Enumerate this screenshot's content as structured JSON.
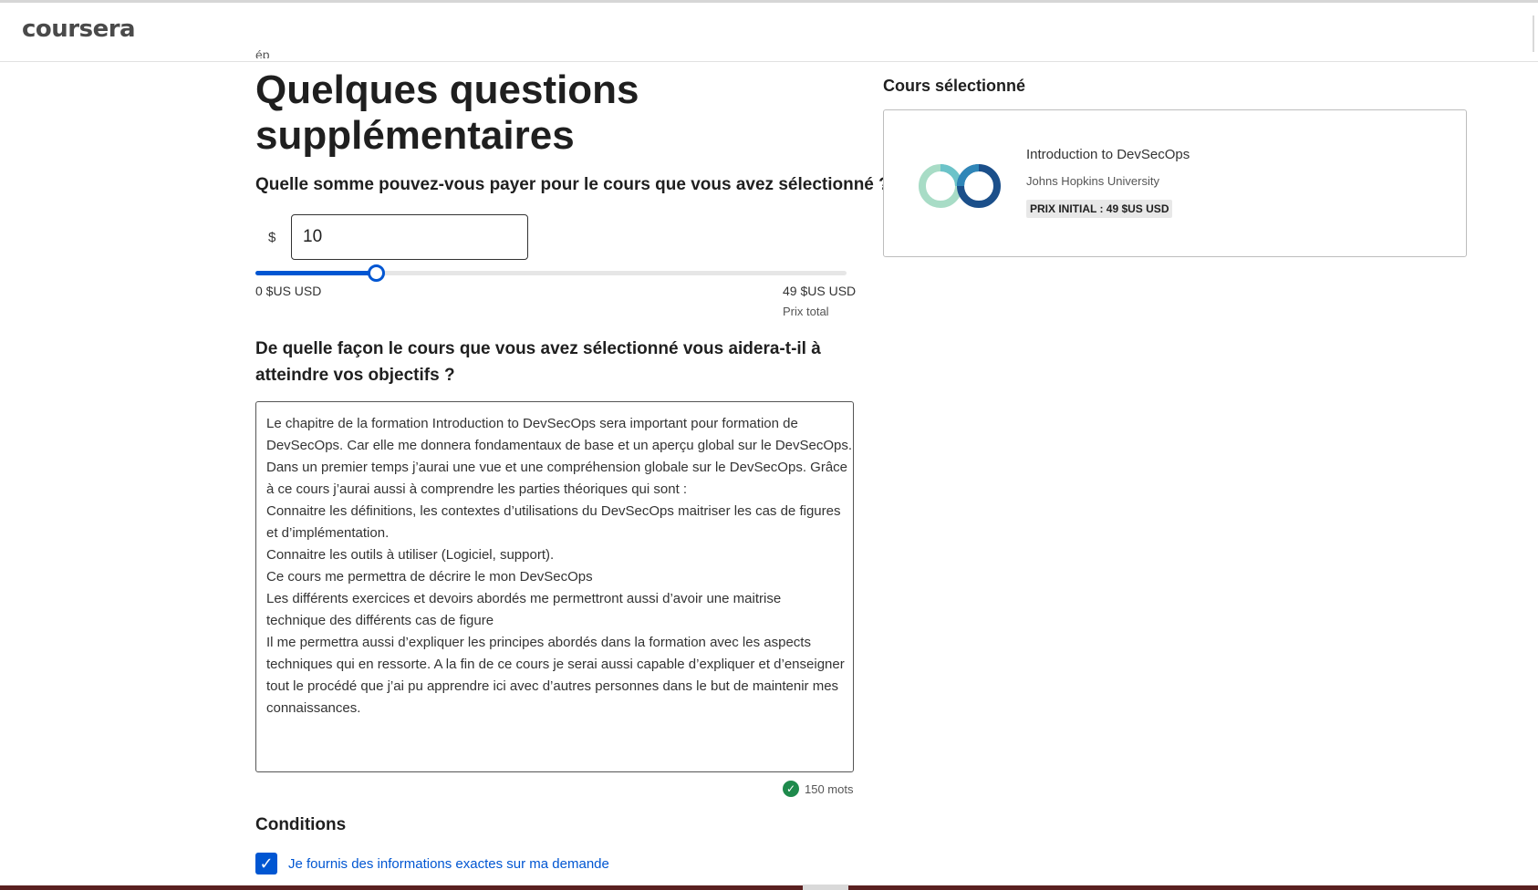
{
  "header": {
    "logo_text": "coursera"
  },
  "form": {
    "title": "Quelques questions supplémentaires",
    "amount_question": "Quelle somme pouvez-vous payer pour le cours que vous avez sélectionné ?",
    "currency_symbol": "$",
    "amount_value": "10",
    "slider": {
      "min_label": "0 $US USD",
      "max_label": "49 $US USD",
      "total_label": "Prix total",
      "value": 10,
      "max": 49
    },
    "goals_question": "De quelle façon le cours que vous avez sélectionné vous aidera-t-il à atteindre vos objectifs ?",
    "goals_lines": [
      "Le chapitre de la formation Introduction to DevSecOps sera important pour formation de",
      "DevSecOps. Car elle me donnera fondamentaux de base et un aperçu global sur le DevSecOps.",
      "Dans un premier temps j’aurai une vue et une compréhension globale sur le DevSecOps. Grâce",
      "à ce cours j’aurai aussi à comprendre les parties théoriques qui sont :",
      "Connaitre les définitions, les contextes d’utilisations du DevSecOps maitriser les cas de figures",
      "et d’implémentation.",
      "Connaitre les outils à utiliser (Logiciel, support).",
      "Ce cours me permettra de décrire le mon DevSecOps",
      "Les différents exercices et devoirs abordés me permettront aussi d’avoir une maitrise",
      "technique des différents cas de figure",
      "Il me permettra aussi d’expliquer les principes abordés dans la formation avec les aspects",
      "techniques qui en ressorte. A la fin de ce cours je serai aussi capable d’expliquer et d’enseigner",
      "tout le procédé que j’ai pu apprendre ici avec d’autres personnes dans le but de maintenir mes",
      "connaissances."
    ],
    "word_count": "150 mots",
    "conditions_title": "Conditions",
    "conditions_checkbox_label": "Je fournis des informations exactes sur ma demande",
    "conditions_checked": true
  },
  "sidebar": {
    "title": "Cours sélectionné",
    "course": {
      "name": "Introduction to DevSecOps",
      "university": "Johns Hopkins University",
      "price_badge": "PRIX INITIAL : 49 $US USD"
    }
  },
  "colors": {
    "accent": "#0056d2",
    "success": "#1e8a4c",
    "text": "#1f1f1f"
  },
  "icons": {
    "check": "check-icon",
    "logo": "devsecops-rings-icon"
  }
}
